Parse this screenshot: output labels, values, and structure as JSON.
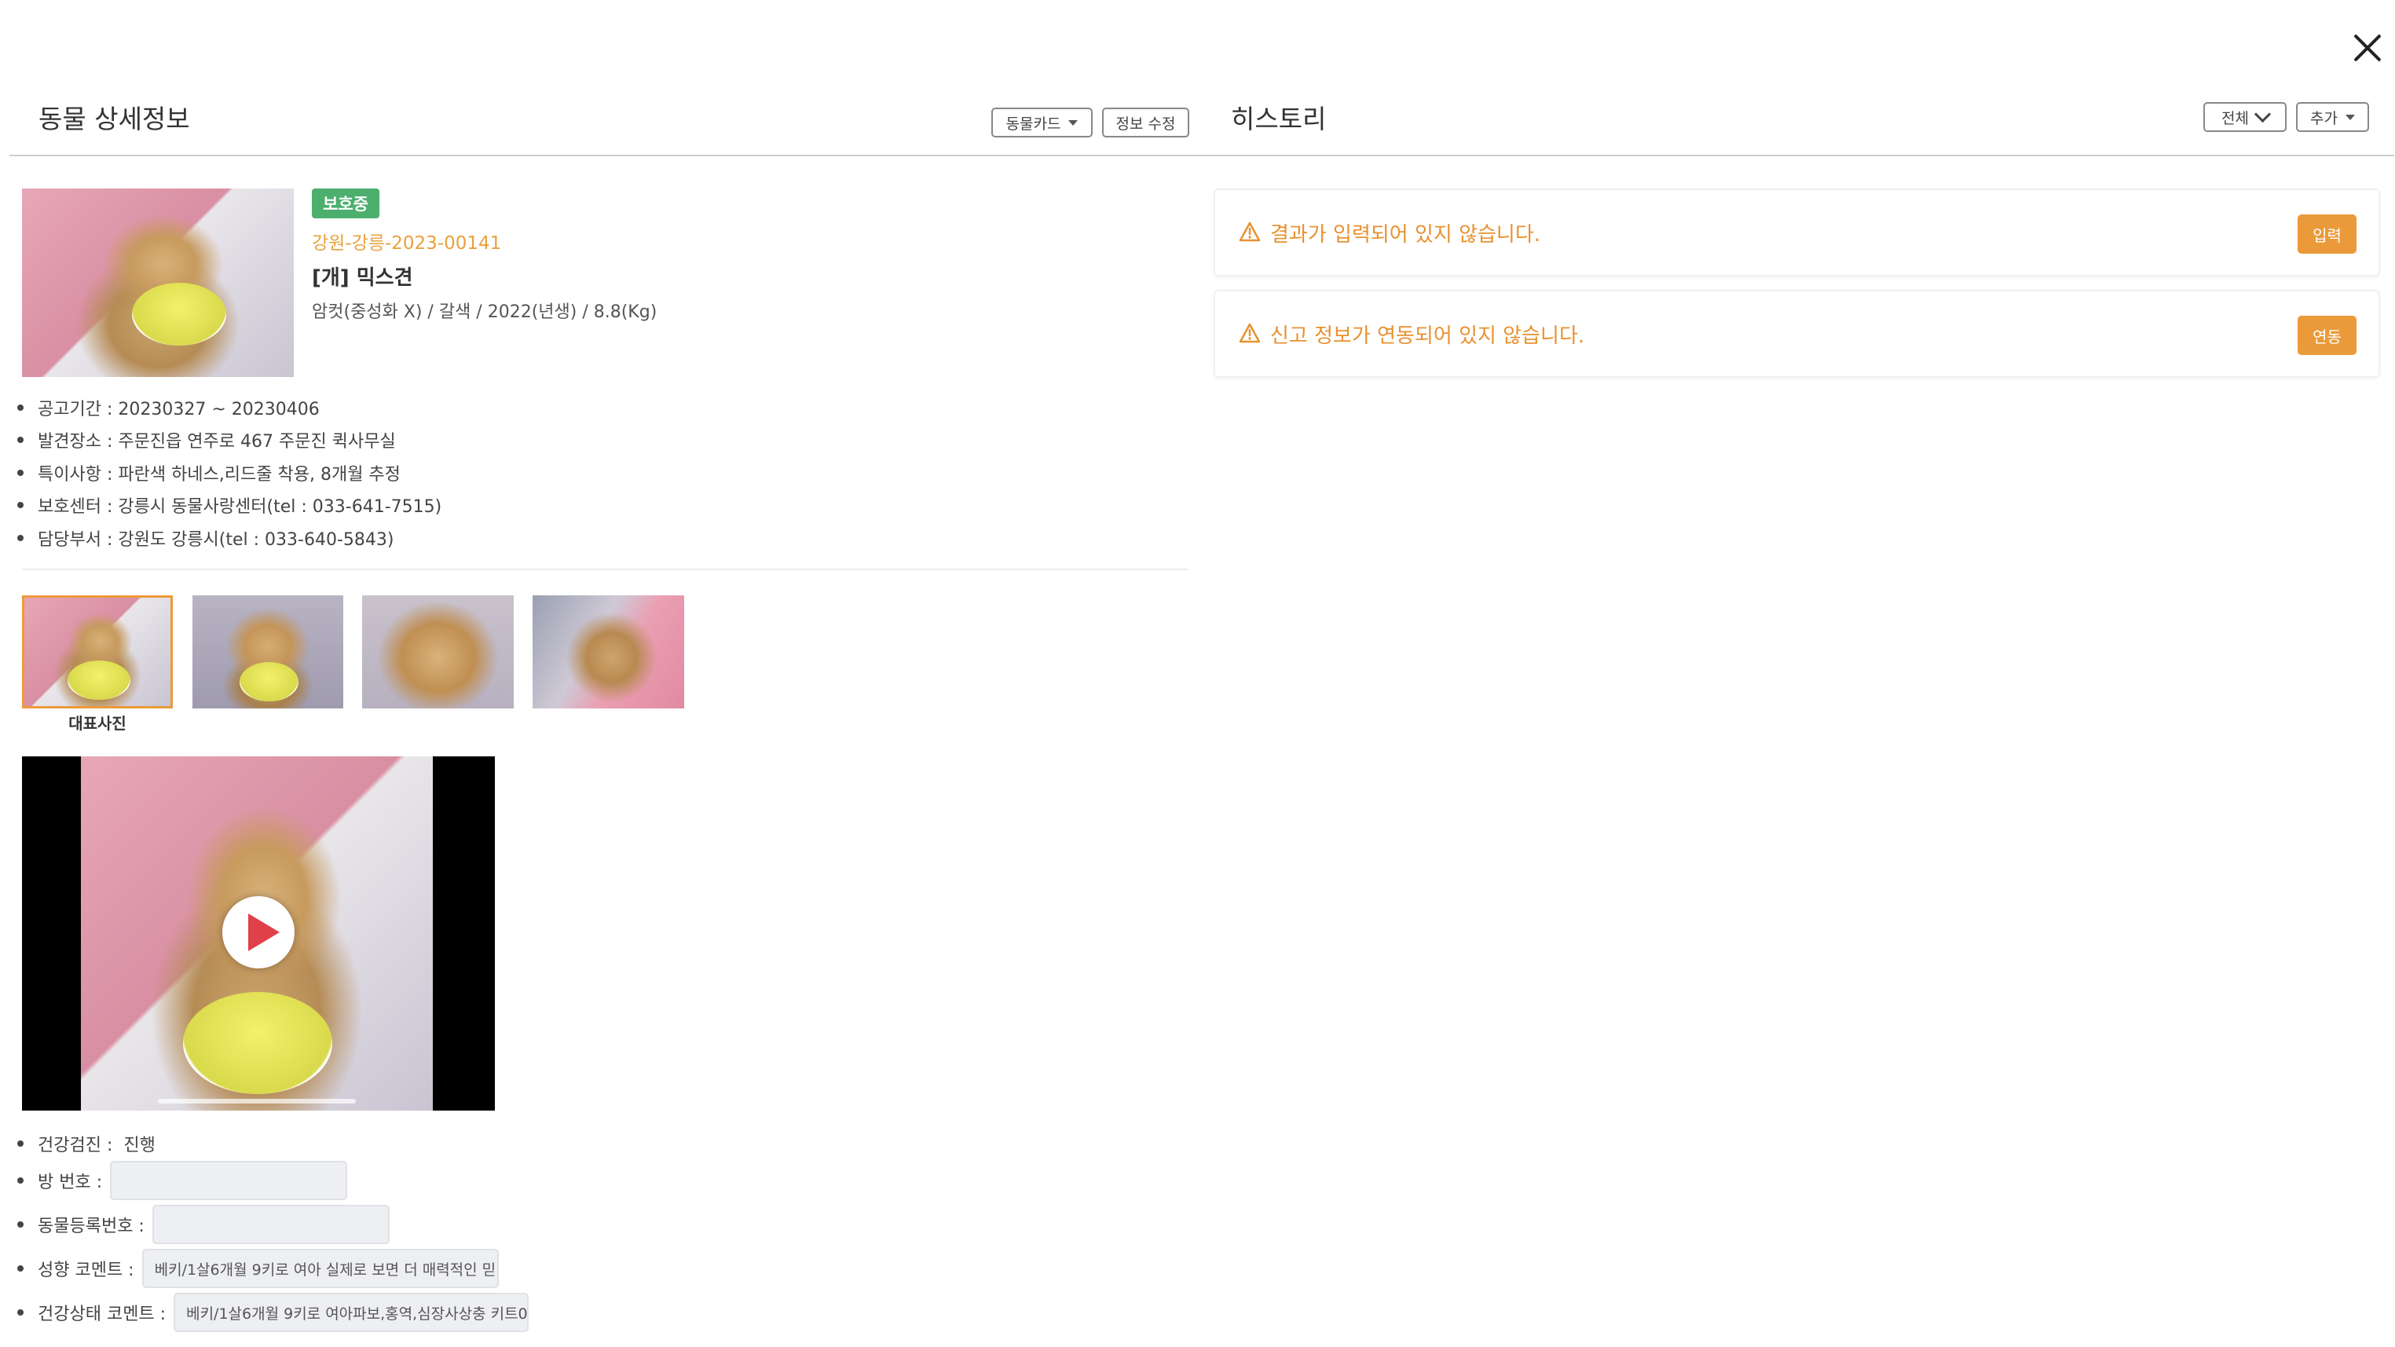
{
  "left_panel": {
    "title": "동물 상세정보",
    "animal_card_button": "동물카드",
    "edit_button": "정보 수정",
    "status_badge": "보호중",
    "registration_no": "강원-강릉-2023-00141",
    "breed": "[개] 믹스견",
    "detail_line": "암컷(중성화 X) / 갈색 / 2022(년생) / 8.8(Kg)",
    "info_items": [
      "공고기간 : 20230327 ~ 20230406",
      "발견장소 : 주문진읍 연주로 467 주문진 퀵사무실",
      "특이사항 : 파란색 하네스,리드줄 착용, 8개월 추정",
      "보호센터 : 강릉시 동물사랑센터(tel : 033-641-7515)",
      "담당부서 : 강원도 강릉시(tel : 033-640-5843)"
    ],
    "thumbnail_caption": "대표사진",
    "extra": {
      "health_check_label": "건강검진 :",
      "health_check_value": "진행",
      "room_no_label": "방 번호 :",
      "room_no_value": "",
      "reg_no_label": "동물등록번호 :",
      "reg_no_value": "",
      "temperament_label": "성향 코멘트 :",
      "temperament_value": "베키/1살6개월 9키로 여아 실제로 보면 더 매력적인 믿",
      "health_comment_label": "건강상태 코멘트 :",
      "health_comment_value": "베키/1살6개월 9키로 여아파보,홍역,심장사상충 키트0"
    }
  },
  "right_panel": {
    "title": "히스토리",
    "filter_select": "전체",
    "add_button": "추가",
    "alerts": [
      {
        "text": "결과가 입력되어 있지 않습니다.",
        "button": "입력"
      },
      {
        "text": "신고 정보가 연동되어 있지 않습니다.",
        "button": "연동"
      }
    ]
  },
  "colors": {
    "accent_orange": "#eb9a3a",
    "warning_text": "#e8912f",
    "status_green": "#4caf6d",
    "registration_text": "#e9a13b"
  },
  "icons": {
    "close": "close-icon",
    "warning": "warning-icon",
    "play": "play-icon",
    "caret": "caret-down-icon",
    "chevron": "chevron-down-icon"
  }
}
